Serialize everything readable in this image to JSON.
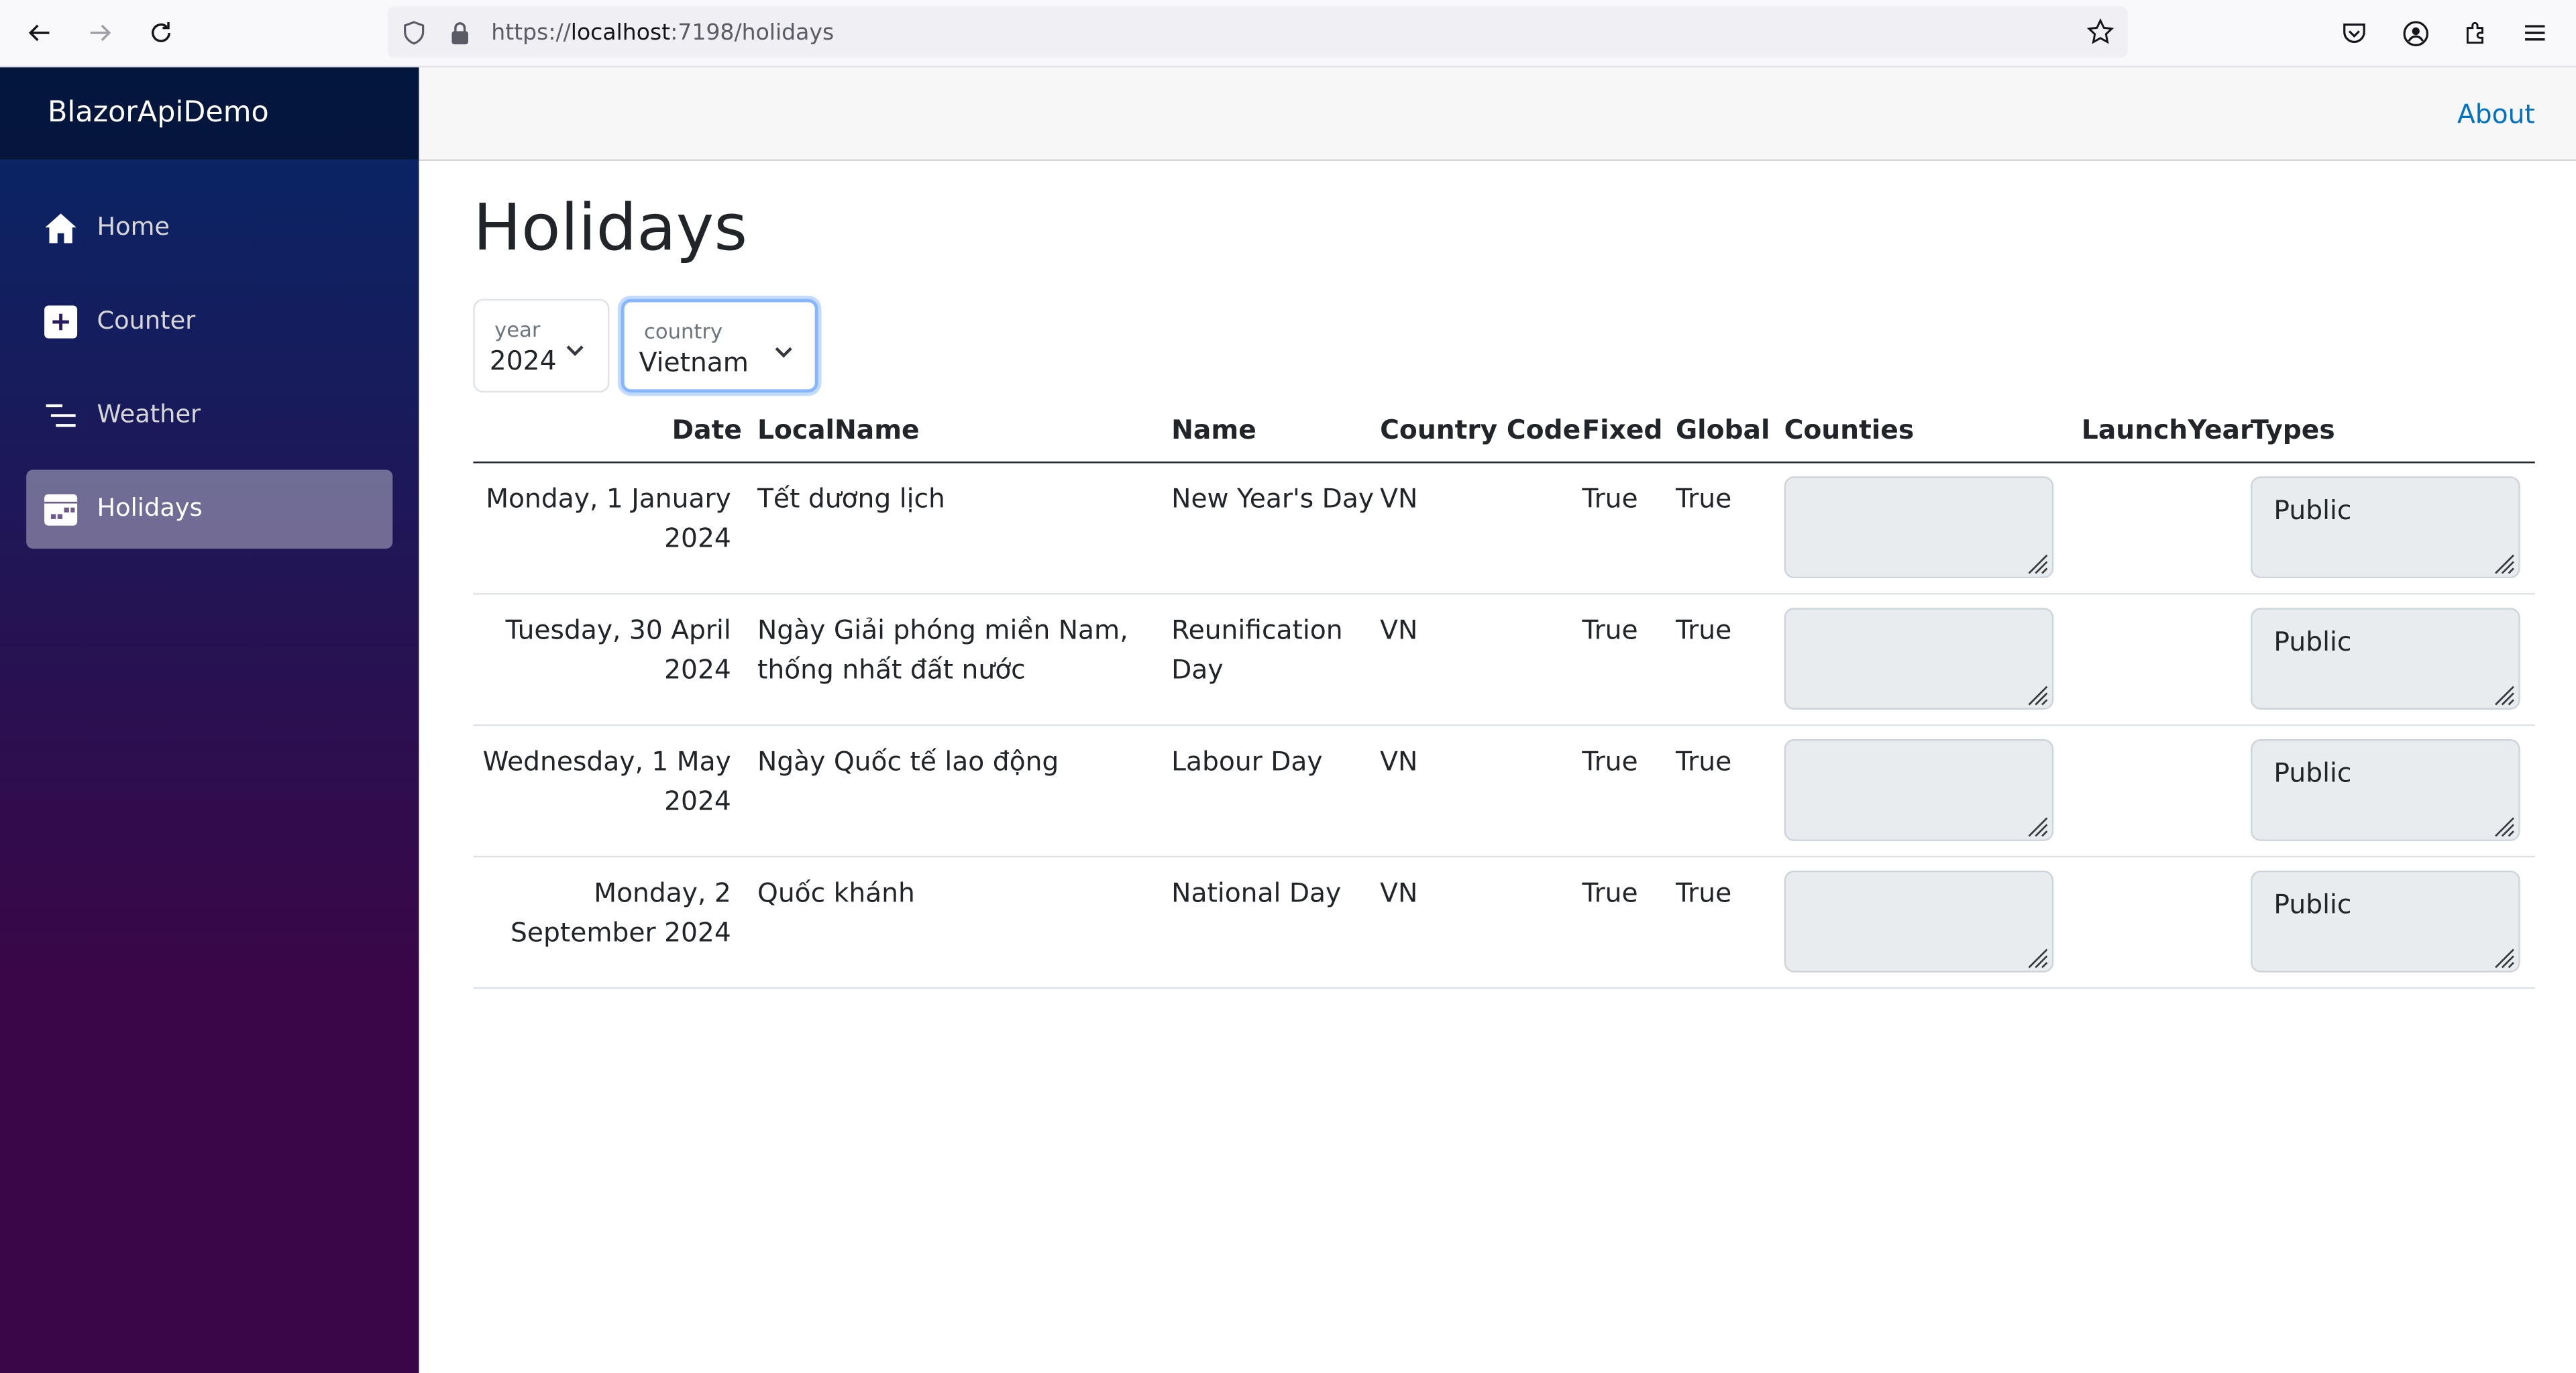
{
  "browser": {
    "url_prefix": "https://",
    "url_host": "localhost",
    "url_rest": ":7198/holidays"
  },
  "sidebar": {
    "brand": "BlazorApiDemo",
    "items": [
      {
        "label": "Home",
        "icon": "home-icon"
      },
      {
        "label": "Counter",
        "icon": "plus-square-icon"
      },
      {
        "label": "Weather",
        "icon": "list-nested-icon"
      },
      {
        "label": "Holidays",
        "icon": "calendar-icon",
        "active": true
      }
    ]
  },
  "top_row": {
    "about_label": "About"
  },
  "page": {
    "title": "Holidays"
  },
  "filters": {
    "year": {
      "label": "year",
      "value": "2024"
    },
    "country": {
      "label": "country",
      "value": "Vietnam"
    }
  },
  "table": {
    "headers": [
      "Date",
      "LocalName",
      "Name",
      "Country Code",
      "Fixed",
      "Global",
      "Counties",
      "LaunchYear",
      "Types"
    ],
    "rows": [
      {
        "date_line1": "Monday, 1 January",
        "date_line2": "2024",
        "local_line1": "Tết dương lịch",
        "local_line2": "",
        "name_line1": "New Year's Day",
        "name_line2": "",
        "code": "VN",
        "fixed": "True",
        "global": "True",
        "counties": "",
        "launch_year": "",
        "types": "Public"
      },
      {
        "date_line1": "Tuesday, 30 April",
        "date_line2": "2024",
        "local_line1": "Ngày Giải phóng miền Nam,",
        "local_line2": "thống nhất đất nước",
        "name_line1": "Reunification",
        "name_line2": "Day",
        "code": "VN",
        "fixed": "True",
        "global": "True",
        "counties": "",
        "launch_year": "",
        "types": "Public"
      },
      {
        "date_line1": "Wednesday, 1 May",
        "date_line2": "2024",
        "local_line1": "Ngày Quốc tế lao động",
        "local_line2": "",
        "name_line1": "Labour Day",
        "name_line2": "",
        "code": "VN",
        "fixed": "True",
        "global": "True",
        "counties": "",
        "launch_year": "",
        "types": "Public"
      },
      {
        "date_line1": "Monday, 2",
        "date_line2": "September 2024",
        "local_line1": "Quốc khánh",
        "local_line2": "",
        "name_line1": "National Day",
        "name_line2": "",
        "code": "VN",
        "fixed": "True",
        "global": "True",
        "counties": "",
        "launch_year": "",
        "types": "Public"
      }
    ]
  },
  "colors": {
    "sidebar_top": "#052767",
    "sidebar_bottom": "#3a0647",
    "link": "#0071c1",
    "focus_ring": "#86b7fe"
  }
}
